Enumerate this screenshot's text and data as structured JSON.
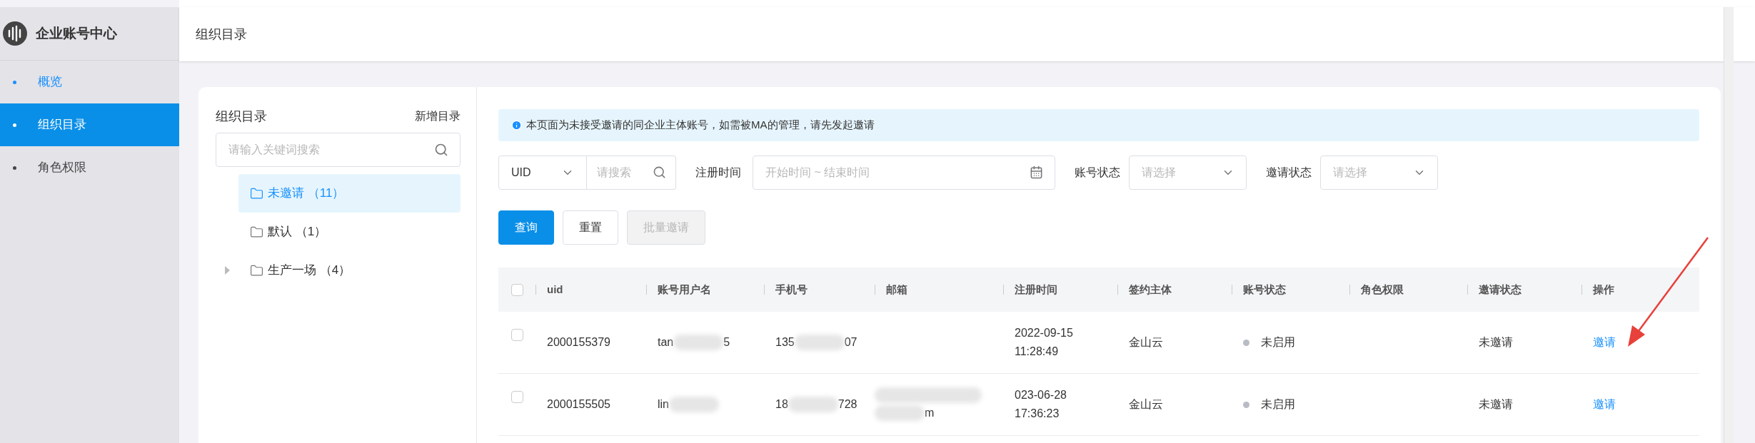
{
  "sidebar": {
    "title": "企业账号中心",
    "items": [
      {
        "label": "概览",
        "selected": false,
        "kind": "link"
      },
      {
        "label": "组织目录",
        "selected": true
      },
      {
        "label": "角色权限",
        "selected": false
      }
    ]
  },
  "header": {
    "title": "组织目录"
  },
  "tree": {
    "title": "组织目录",
    "add_label": "新增目录",
    "search": {
      "placeholder": "请输入关键词搜索"
    },
    "items": [
      {
        "label": "未邀请 （11）",
        "selected": true,
        "expandable": false
      },
      {
        "label": "默认 （1）",
        "selected": false,
        "expandable": false
      },
      {
        "label": "生产一场 （4）",
        "selected": false,
        "expandable": true
      }
    ]
  },
  "notice": "本页面为未接受邀请的同企业主体账号，如需被MA的管理，请先发起邀请",
  "filters": {
    "type_select": "UID",
    "search_placeholder": "请搜索",
    "date_label": "注册时间",
    "date_placeholder": "开始时间 ~ 结束时间",
    "account_status_label": "账号状态",
    "account_status_placeholder": "请选择",
    "invite_status_label": "邀请状态",
    "invite_status_placeholder": "请选择"
  },
  "buttons": [
    {
      "label": "查询",
      "kind": "primary",
      "disabled": false
    },
    {
      "label": "重置",
      "kind": "default",
      "disabled": false
    },
    {
      "label": "批量邀请",
      "kind": "default",
      "disabled": true
    }
  ],
  "table": {
    "select_all_checked": false,
    "columns": [
      "uid",
      "账号用户名",
      "手机号",
      "邮箱",
      "注册时间",
      "签约主体",
      "账号状态",
      "角色权限",
      "邀请状态",
      "操作"
    ],
    "rows": [
      {
        "checked": false,
        "uid": "2000155379",
        "username": [
          "tan",
          "5"
        ],
        "phone": [
          "135",
          "07"
        ],
        "registered": [
          "2022-09-15",
          "11:28:49"
        ],
        "entity": "金山云",
        "account_status": "未启用",
        "enabled": false,
        "invite_status": "未邀请",
        "action": "邀请"
      },
      {
        "checked": false,
        "uid": "2000155505",
        "username": [
          "lin"
        ],
        "phone": [
          "18",
          "728"
        ],
        "email": [
          "m"
        ],
        "registered": [
          "023-06-28",
          "17:36:23"
        ],
        "entity": "金山云",
        "account_status": "未启用",
        "enabled": false,
        "invite_status": "未邀请",
        "action": "邀请"
      }
    ]
  }
}
